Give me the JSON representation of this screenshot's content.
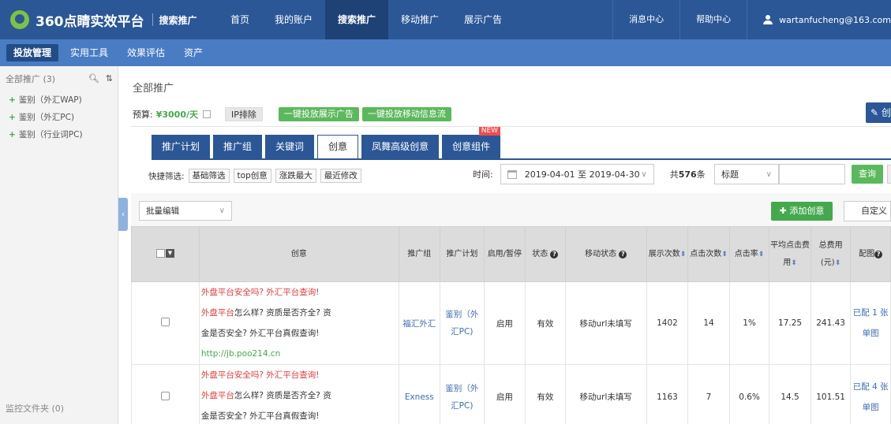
{
  "header": {
    "logo_text": "360点睛实效平台",
    "logo_sub": "搜索推广",
    "nav": [
      {
        "label": "首页",
        "active": false
      },
      {
        "label": "我的账户",
        "active": false
      },
      {
        "label": "搜索推广",
        "active": true
      },
      {
        "label": "移动推广",
        "active": false
      },
      {
        "label": "展示广告",
        "active": false
      }
    ],
    "messages": "消息中心",
    "help": "帮助中心",
    "user": "wartanfucheng@163.com"
  },
  "subnav": [
    {
      "label": "投放管理",
      "active": true
    },
    {
      "label": "实用工具",
      "active": false
    },
    {
      "label": "效果评估",
      "active": false
    },
    {
      "label": "资产",
      "active": false
    }
  ],
  "sidebar": {
    "title": "全部推广 (3)",
    "items": [
      "鉴别（外汇WAP)",
      "鉴别（外汇PC)",
      "鉴别（行业词PC)"
    ],
    "footer": "监控文件夹 (0)"
  },
  "main": {
    "title": "全部推广",
    "budget_label": "预算:",
    "budget_value": "¥3000/天",
    "ip_exclude": "IP排除",
    "btn_display": "一键投放展示广告",
    "btn_mobile": "一键投放移动信息流",
    "corner_btn": "✎ 创",
    "tabs": [
      {
        "label": "推广计划",
        "active": false
      },
      {
        "label": "推广组",
        "active": false
      },
      {
        "label": "关键词",
        "active": false
      },
      {
        "label": "创意",
        "active": true
      },
      {
        "label": "凤舞高级创意",
        "active": false
      },
      {
        "label": "创意组件",
        "active": false,
        "badge": "NEW"
      }
    ],
    "quick_filter_label": "快捷筛选:",
    "quick_filters": [
      "基础筛选",
      "top创意",
      "涨跌最大",
      "最近修改"
    ],
    "time_label": "时间:",
    "date_range": "2019-04-01 至 2019-04-30",
    "total_prefix": "共",
    "total_count": "576",
    "total_suffix": "条",
    "field_select": "标题",
    "query_btn": "查询",
    "batch_edit": "批量编辑",
    "add_creative": "添加创意",
    "custom_cols": "自定义"
  },
  "table": {
    "headers": {
      "creative": "创意",
      "group": "推广组",
      "plan": "推广计划",
      "enable": "启用/暂停",
      "status": "状态",
      "mobile_status": "移动状态",
      "impressions": "展示次数",
      "clicks": "点击次数",
      "ctr": "点击率",
      "avg_cpc_1": "平均点击费",
      "avg_cpc_2": "用",
      "cost_1": "总费用",
      "cost_2": "(元)",
      "image": "配图"
    },
    "rows": [
      {
        "title_red": "外盘平台",
        "title_rest": "安全吗? 外汇平台查询!",
        "desc_red": "外盘平台",
        "desc_rest": "怎么样? 资质是否齐全? 资",
        "desc_line2": "金是否安全? 外汇平台真假查询!",
        "url": "http://jb.poo214.cn",
        "group": "福汇外汇",
        "plan_1": "鉴别（外",
        "plan_2": "汇PC)",
        "enable": "启用",
        "status": "有效",
        "mobile_status": "移动url未填写",
        "impressions": "1402",
        "clicks": "14",
        "ctr": "1%",
        "avg_cpc": "17.25",
        "cost": "241.43",
        "image_1": "已配 1 张",
        "image_2": "单图"
      },
      {
        "title_red": "外盘平台",
        "title_rest": "安全吗? 外汇平台查询!",
        "desc_red": "外盘平台",
        "desc_rest": "怎么样? 资质是否齐全? 资",
        "desc_line2": "金是否安全? 外汇平台真假查询!",
        "url": "",
        "group": "Exness",
        "plan_1": "鉴别（外",
        "plan_2": "汇PC)",
        "enable": "启用",
        "status": "有效",
        "mobile_status": "移动url未填写",
        "impressions": "1163",
        "clicks": "7",
        "ctr": "0.6%",
        "avg_cpc": "14.5",
        "cost": "101.51",
        "image_1": "已配 4 张",
        "image_2": "单图"
      }
    ]
  }
}
